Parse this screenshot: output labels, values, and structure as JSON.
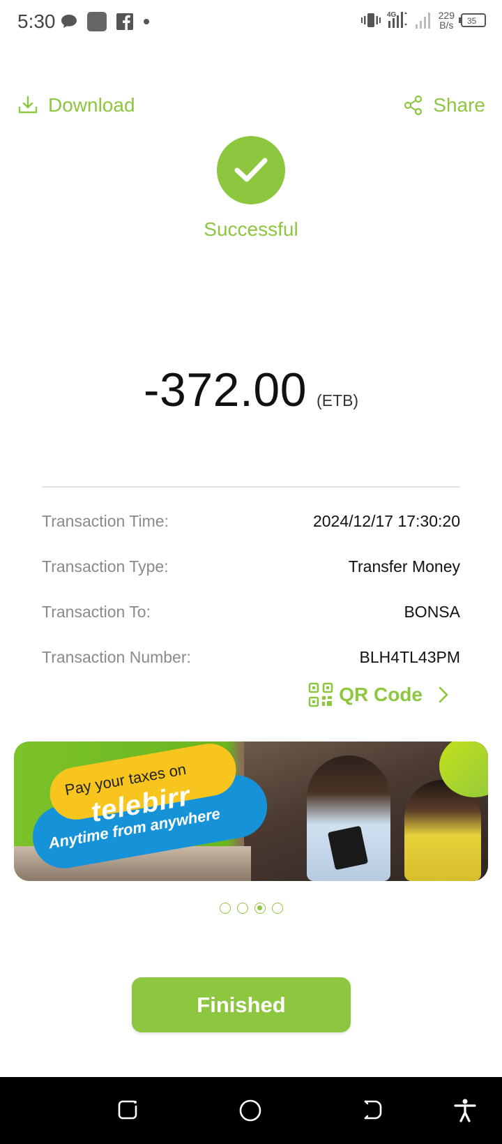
{
  "status_bar": {
    "time": "5:30",
    "network": "4G",
    "speed_value": "229",
    "speed_unit": "B/s",
    "battery": "35"
  },
  "header": {
    "download_label": "Download",
    "share_label": "Share"
  },
  "status": {
    "text": "Successful"
  },
  "amount": {
    "value": "-372.00",
    "currency": "(ETB)"
  },
  "details": [
    {
      "label": "Transaction Time:",
      "value": "2024/12/17 17:30:20"
    },
    {
      "label": "Transaction Type:",
      "value": "Transfer Money"
    },
    {
      "label": "Transaction To:",
      "value": "BONSA"
    },
    {
      "label": "Transaction Number:",
      "value": "BLH4TL43PM"
    }
  ],
  "qr": {
    "label": "QR Code"
  },
  "banner": {
    "line1": "Pay your taxes on",
    "line2": "telebirr",
    "line3": "Anytime from anywhere",
    "active_slide": 3,
    "slide_count": 4
  },
  "finish_button": {
    "label": "Finished"
  },
  "colors": {
    "accent": "#8dc63f",
    "label_gray": "#8a8a8a"
  }
}
